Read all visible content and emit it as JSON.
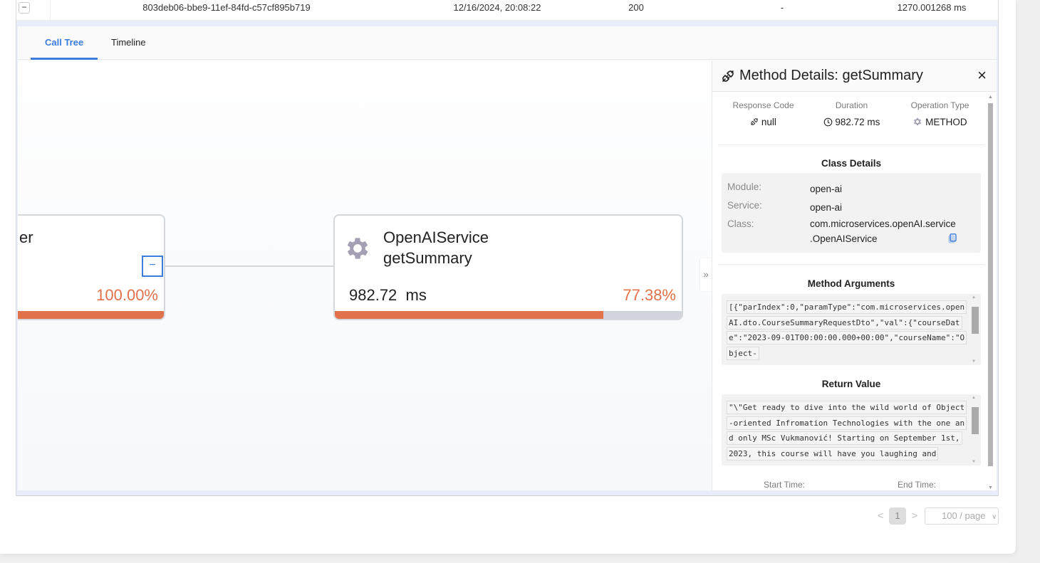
{
  "trace_row": {
    "expand_symbol": "−",
    "trace_id": "803deb06-bbe9-11ef-84fd-c57cf895b719",
    "timestamp": "12/16/2024, 20:08:22",
    "status": "200",
    "error": "-",
    "duration": "1270.001268 ms"
  },
  "tabs": [
    {
      "label": "Call Tree",
      "active": true
    },
    {
      "label": "Timeline",
      "active": false
    }
  ],
  "call_tree": {
    "root_node": {
      "name_partial": "er",
      "collapse_symbol": "−",
      "percent": "100.00%",
      "percent_value": 100.0
    },
    "child_node": {
      "class_name": "OpenAIService",
      "method_name": "getSummary",
      "duration": "982.72  ms",
      "percent": "77.38%",
      "percent_value": 77.38,
      "icon": "gear-icon"
    },
    "panel_toggle": "»"
  },
  "method_details": {
    "title": "Method Details: getSummary",
    "close_symbol": "×",
    "stats": {
      "response_code_label": "Response Code",
      "response_code_value": "null",
      "duration_label": "Duration",
      "duration_value": "982.72 ms",
      "operation_type_label": "Operation Type",
      "operation_type_value": "METHOD"
    },
    "class_details": {
      "title": "Class Details",
      "module_label": "Module:",
      "module_value": "open-ai",
      "service_label": "Service:",
      "service_value": "open-ai",
      "class_label": "Class:",
      "class_value_line1": "com.microservices.openAI.service",
      "class_value_line2": ".OpenAIService"
    },
    "method_arguments": {
      "title": "Method Arguments",
      "value": "[{\"parIndex\":0,\"paramType\":\"com.microservices.openAI.dto.CourseSummaryRequestDto\",\"val\":{\"courseDate\":\"2023-09-01T00:00:00.000+00:00\",\"courseName\":\"Object-"
    },
    "return_value": {
      "title": "Return Value",
      "value": "\"\\\"Get ready to dive into the wild world of Object-oriented Infromation Technologies with the one and only MSc Vukmanović! Starting on September 1st, 2023, this course will have you laughing and"
    },
    "start_time_label": "Start Time:",
    "end_time_label": "End Time:"
  },
  "pagination": {
    "prev": "<",
    "current_page": "1",
    "next": ">",
    "page_size": "100 / page",
    "dropdown_symbol": "∨"
  },
  "colors": {
    "accent": "#3b7ddd",
    "percent": "#e0714a",
    "bar_track": "#d1d5db"
  }
}
